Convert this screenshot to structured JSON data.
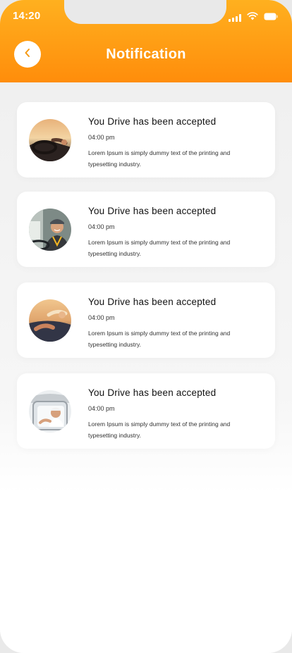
{
  "status_bar": {
    "time": "14:20"
  },
  "header": {
    "title": "Notification"
  },
  "notifications": [
    {
      "title": "You Drive has been accepted",
      "time": "04:00 pm",
      "body": "Lorem Ipsum is simply dummy text of the printing and typesetting industry."
    },
    {
      "title": "You Drive has been accepted",
      "time": "04:00 pm",
      "body": "Lorem Ipsum is simply dummy text of the printing and typesetting industry."
    },
    {
      "title": "You Drive has been accepted",
      "time": "04:00 pm",
      "body": "Lorem Ipsum is simply dummy text of the printing and typesetting industry."
    },
    {
      "title": "You Drive has been accepted",
      "time": "04:00 pm",
      "body": "Lorem Ipsum is simply dummy text of the printing and typesetting industry."
    }
  ],
  "icons": {
    "back": "chevron-left-icon",
    "signal": "cellular-signal-icon",
    "wifi": "wifi-icon",
    "battery": "battery-icon"
  },
  "colors": {
    "accent_top": "#ffb01f",
    "accent_bottom": "#ff8d0b",
    "back_chevron": "#f59a14"
  }
}
